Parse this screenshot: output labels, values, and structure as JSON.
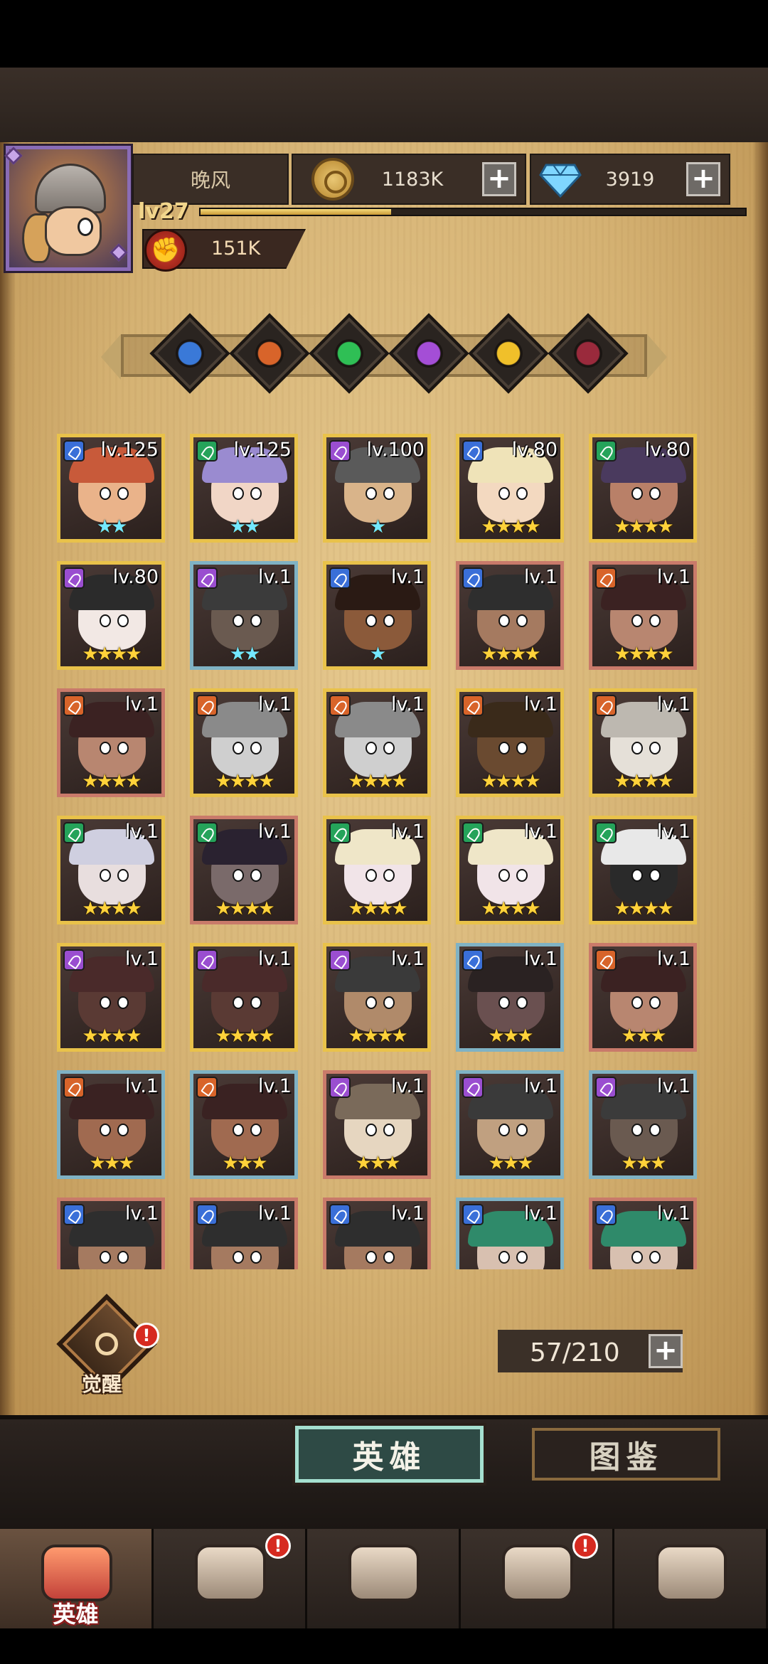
{
  "player": {
    "name": "晚风",
    "level": "lv27",
    "xp_fraction": 0.35,
    "power": "151K"
  },
  "currencies": {
    "gold": "1183K",
    "gems": "3919"
  },
  "factions": [
    {
      "icon": "faction-blue-icon",
      "color": "#3a79d8"
    },
    {
      "icon": "faction-orange-icon",
      "color": "#d8642a"
    },
    {
      "icon": "faction-green-icon",
      "color": "#2fbf55"
    },
    {
      "icon": "faction-purple-icon",
      "color": "#a44ed6"
    },
    {
      "icon": "faction-gold-icon",
      "color": "#f0c02a"
    },
    {
      "icon": "faction-dark-icon",
      "color": "#9a2a3c"
    }
  ],
  "heroes": [
    {
      "level": "lv.125",
      "stars": "★★",
      "star_color": "cyan",
      "frame": "#e9c24a",
      "class_color": "#3a6fd8",
      "hair": "#c85a3a",
      "skin": "#eab38a"
    },
    {
      "level": "lv.125",
      "stars": "★★",
      "star_color": "cyan",
      "frame": "#e9c24a",
      "class_color": "#25a35a",
      "hair": "#9a8bd0",
      "skin": "#f1d6c6"
    },
    {
      "level": "lv.100",
      "stars": "★",
      "star_color": "cyan",
      "frame": "#e9c24a",
      "class_color": "#9a4ed0",
      "hair": "#5a5a5a",
      "skin": "#d9b48a"
    },
    {
      "level": "lv.80",
      "stars": "★★★★",
      "star_color": "gold",
      "frame": "#e9c24a",
      "class_color": "#3a6fd8",
      "hair": "#efe3b8",
      "skin": "#f3d9c0"
    },
    {
      "level": "lv.80",
      "stars": "★★★★",
      "star_color": "gold",
      "frame": "#e9c24a",
      "class_color": "#25a35a",
      "hair": "#4a3a5e",
      "skin": "#b98068"
    },
    {
      "level": "lv.80",
      "stars": "★★★★",
      "star_color": "gold",
      "frame": "#e9c24a",
      "class_color": "#9a4ed0",
      "hair": "#2b2b2b",
      "skin": "#f2e8e4"
    },
    {
      "level": "lv.1",
      "stars": "★★",
      "star_color": "cyan",
      "frame": "#7fb2c4",
      "class_color": "#9a4ed0",
      "hair": "#3b3b3b",
      "skin": "#6a5a50"
    },
    {
      "level": "lv.1",
      "stars": "★",
      "star_color": "cyan",
      "frame": "#e9c24a",
      "class_color": "#3a6fd8",
      "hair": "#2a1a14",
      "skin": "#8b5a3a"
    },
    {
      "level": "lv.1",
      "stars": "★★★★",
      "star_color": "gold",
      "frame": "#c97a6a",
      "class_color": "#3a6fd8",
      "hair": "#2e2e2e",
      "skin": "#a57a60"
    },
    {
      "level": "lv.1",
      "stars": "★★★★",
      "star_color": "gold",
      "frame": "#c97a6a",
      "class_color": "#d8642a",
      "hair": "#3b2222",
      "skin": "#b88670"
    },
    {
      "level": "lv.1",
      "stars": "★★★★",
      "star_color": "gold",
      "frame": "#c97a6a",
      "class_color": "#d8642a",
      "hair": "#3b2222",
      "skin": "#b88670"
    },
    {
      "level": "lv.1",
      "stars": "★★★★",
      "star_color": "gold",
      "frame": "#e9c24a",
      "class_color": "#d8642a",
      "hair": "#8a8a8a",
      "skin": "#cfcfcf"
    },
    {
      "level": "lv.1",
      "stars": "★★★★",
      "star_color": "gold",
      "frame": "#e9c24a",
      "class_color": "#d8642a",
      "hair": "#8a8a8a",
      "skin": "#cfcfcf"
    },
    {
      "level": "lv.1",
      "stars": "★★★★",
      "star_color": "gold",
      "frame": "#e9c24a",
      "class_color": "#d8642a",
      "hair": "#3a2a1a",
      "skin": "#6a4a30"
    },
    {
      "level": "lv.1",
      "stars": "★★★★",
      "star_color": "gold",
      "frame": "#e9c24a",
      "class_color": "#d8642a",
      "hair": "#bdb8b0",
      "skin": "#e5e0d8"
    },
    {
      "level": "lv.1",
      "stars": "★★★★",
      "star_color": "gold",
      "frame": "#e9c24a",
      "class_color": "#25a35a",
      "hair": "#cfcfe0",
      "skin": "#e8dede"
    },
    {
      "level": "lv.1",
      "stars": "★★★★",
      "star_color": "gold",
      "frame": "#c97a6a",
      "class_color": "#25a35a",
      "hair": "#2a2230",
      "skin": "#7a6a6a"
    },
    {
      "level": "lv.1",
      "stars": "★★★★",
      "star_color": "gold",
      "frame": "#e9c24a",
      "class_color": "#25a35a",
      "hair": "#efe6c8",
      "skin": "#f1e4e8"
    },
    {
      "level": "lv.1",
      "stars": "★★★★",
      "star_color": "gold",
      "frame": "#e9c24a",
      "class_color": "#25a35a",
      "hair": "#efe6c8",
      "skin": "#f1e4e8"
    },
    {
      "level": "lv.1",
      "stars": "★★★★",
      "star_color": "gold",
      "frame": "#e9c24a",
      "class_color": "#25a35a",
      "hair": "#e8e8e8",
      "skin": "#2a2a2a"
    },
    {
      "level": "lv.1",
      "stars": "★★★★",
      "star_color": "gold",
      "frame": "#e9c24a",
      "class_color": "#9a4ed0",
      "hair": "#4a2a2a",
      "skin": "#5a3a34"
    },
    {
      "level": "lv.1",
      "stars": "★★★★",
      "star_color": "gold",
      "frame": "#e9c24a",
      "class_color": "#9a4ed0",
      "hair": "#4a2a2a",
      "skin": "#5a3a34"
    },
    {
      "level": "lv.1",
      "stars": "★★★★",
      "star_color": "gold",
      "frame": "#e9c24a",
      "class_color": "#9a4ed0",
      "hair": "#3a3a3a",
      "skin": "#b08a6a"
    },
    {
      "level": "lv.1",
      "stars": "★★★",
      "star_color": "gold",
      "frame": "#7fb2c4",
      "class_color": "#3a6fd8",
      "hair": "#2a2222",
      "skin": "#6a5050"
    },
    {
      "level": "lv.1",
      "stars": "★★★",
      "star_color": "gold",
      "frame": "#c97a6a",
      "class_color": "#d8642a",
      "hair": "#3b2222",
      "skin": "#b88670"
    },
    {
      "level": "lv.1",
      "stars": "★★★",
      "star_color": "gold",
      "frame": "#7fb2c4",
      "class_color": "#d8642a",
      "hair": "#3a2222",
      "skin": "#a06a50"
    },
    {
      "level": "lv.1",
      "stars": "★★★",
      "star_color": "gold",
      "frame": "#7fb2c4",
      "class_color": "#d8642a",
      "hair": "#3a2222",
      "skin": "#a06a50"
    },
    {
      "level": "lv.1",
      "stars": "★★★",
      "star_color": "gold",
      "frame": "#c97a6a",
      "class_color": "#9a4ed0",
      "hair": "#7a6a5a",
      "skin": "#e6d6c0"
    },
    {
      "level": "lv.1",
      "stars": "★★★",
      "star_color": "gold",
      "frame": "#7fb2c4",
      "class_color": "#9a4ed0",
      "hair": "#3a3a3a",
      "skin": "#c0a080"
    },
    {
      "level": "lv.1",
      "stars": "★★★",
      "star_color": "gold",
      "frame": "#7fb2c4",
      "class_color": "#9a4ed0",
      "hair": "#3b3b3b",
      "skin": "#6a5a50"
    },
    {
      "level": "lv.1",
      "stars": "",
      "star_color": "gold",
      "frame": "#c97a6a",
      "class_color": "#3a6fd8",
      "hair": "#2e2e2e",
      "skin": "#a57a60"
    },
    {
      "level": "lv.1",
      "stars": "",
      "star_color": "gold",
      "frame": "#c97a6a",
      "class_color": "#3a6fd8",
      "hair": "#2e2e2e",
      "skin": "#a57a60"
    },
    {
      "level": "lv.1",
      "stars": "",
      "star_color": "gold",
      "frame": "#c97a6a",
      "class_color": "#3a6fd8",
      "hair": "#2e2e2e",
      "skin": "#a57a60"
    },
    {
      "level": "lv.1",
      "stars": "",
      "star_color": "gold",
      "frame": "#7fb2c4",
      "class_color": "#3a6fd8",
      "hair": "#2f8a6a",
      "skin": "#d8c0b0"
    },
    {
      "level": "lv.1",
      "stars": "",
      "star_color": "gold",
      "frame": "#c97a6a",
      "class_color": "#3a6fd8",
      "hair": "#2f8a6a",
      "skin": "#d8c0b0"
    }
  ],
  "awaken": {
    "label": "觉醒",
    "badge": "!"
  },
  "capacity": {
    "value": "57/210"
  },
  "tabs": {
    "heroes": "英雄",
    "codex": "图鉴"
  },
  "navbar": [
    {
      "label": "英雄",
      "icon": "hero-helmet-icon",
      "active": true,
      "badge": ""
    },
    {
      "label": "",
      "icon": "voyage-flag-icon",
      "active": false,
      "badge": "!"
    },
    {
      "label": "",
      "icon": "battle-swords-icon",
      "active": false,
      "badge": ""
    },
    {
      "label": "",
      "icon": "castle-icon",
      "active": false,
      "badge": "!"
    },
    {
      "label": "",
      "icon": "guild-handshake-icon",
      "active": false,
      "badge": ""
    }
  ]
}
